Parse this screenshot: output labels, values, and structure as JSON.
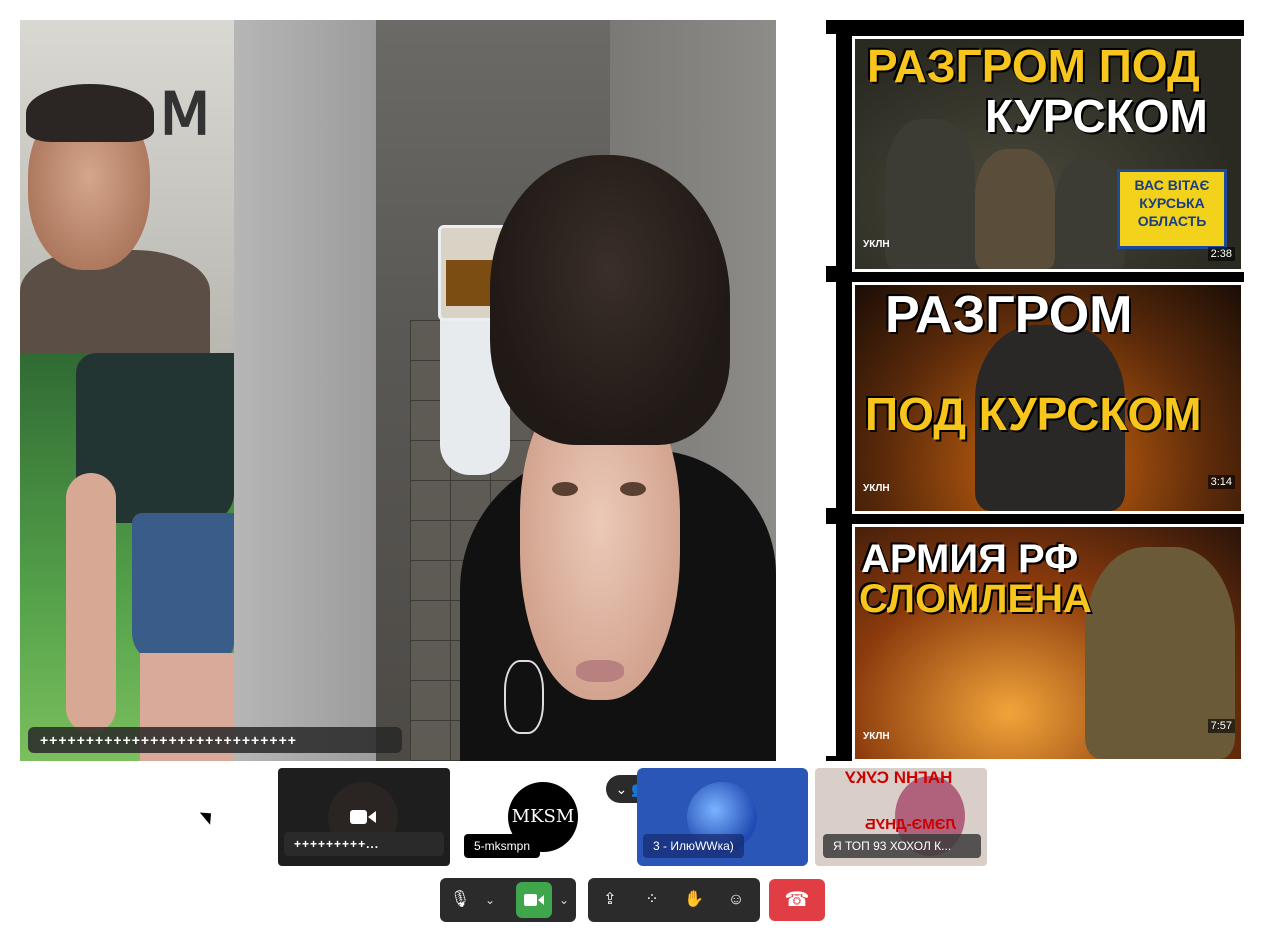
{
  "main_video": {
    "name_label": "++++++++++++++++++++++++++++"
  },
  "share": {
    "thumbs": [
      {
        "title_top": "РАЗГРОМ ПОД",
        "title_bottom": "КУРСКОМ",
        "sign": "ВАС ВІТАЄ КУРСЬКА ОБЛАСТЬ",
        "duration": "2:38",
        "channel": "УКЛН"
      },
      {
        "title_top": "РАЗГРОМ",
        "title_bottom": "ПОД КУРСКОМ",
        "duration": "3:14",
        "channel": "УКЛН"
      },
      {
        "title_top": "АРМИЯ РФ",
        "title_bottom": "СЛОМЛЕНА",
        "duration": "7:57",
        "channel": "УКЛН"
      }
    ]
  },
  "participants": [
    {
      "label": "+++++++++...",
      "icon": "video-camera-icon"
    },
    {
      "label": "5-mksmpn",
      "avatar_text": "MKSM"
    },
    {
      "label": "3 - ИлюWWка)"
    },
    {
      "label": "Я ТОП 93 ХОХОЛ К...",
      "overlay_top": "НАГНИ СУКУ",
      "overlay_bottom": "ЛЭМЭ-ДНУБ"
    }
  ],
  "toolbar": {
    "mic": "🎙",
    "camera": "■",
    "share": "⇪",
    "layout": "⁘",
    "raise_hand": "✋",
    "reactions": "☺",
    "end": "☎",
    "caret": "⌄"
  },
  "colors": {
    "camera_active": "#3fa64c",
    "end_call": "#e03d44",
    "active_speaker_tile": "#2a57b7"
  }
}
